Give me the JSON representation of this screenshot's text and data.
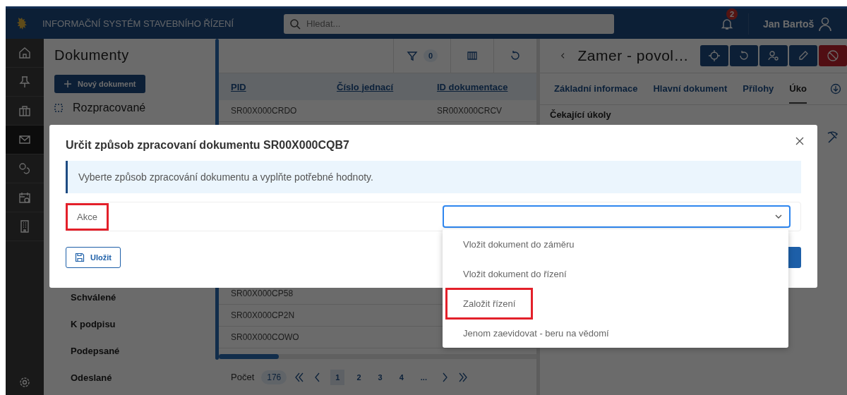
{
  "header": {
    "title": "INFORMAČNÍ SYSTÉM STAVEBNÍHO ŘÍZENÍ",
    "search": {
      "placeholder": "Hledat..."
    },
    "notifications": "2",
    "user": "Jan Bartoš"
  },
  "nav_rail": [
    {
      "kind": "home",
      "selected": false
    },
    {
      "kind": "pin",
      "selected": false
    },
    {
      "kind": "briefcase",
      "selected": false
    },
    {
      "kind": "mail",
      "selected": true
    },
    {
      "kind": "coins",
      "selected": false
    },
    {
      "kind": "calendar",
      "selected": false
    },
    {
      "kind": "building",
      "selected": false
    }
  ],
  "documents": {
    "title": "Dokumenty",
    "new_button": "Nový dokument",
    "folders": [
      {
        "kind": "group",
        "label": "Rozpracované"
      },
      {
        "kind": "item",
        "label": "Schválené"
      },
      {
        "kind": "item",
        "label": "K podpisu"
      },
      {
        "kind": "item",
        "label": "Podepsané"
      },
      {
        "kind": "item",
        "label": "Odeslané"
      }
    ]
  },
  "table": {
    "filter_count": "0",
    "columns": [
      "PID",
      "Číslo jednací",
      "ID dokumentace"
    ],
    "rows": [
      {
        "pid": "SR00X000CRDO",
        "id_dokumentace": "SR00X000CRCV"
      },
      {
        "pid": "SR00X000CP58"
      },
      {
        "pid": "SR00X000CP2N"
      },
      {
        "pid": "SR00X000COWO"
      }
    ],
    "pagination": {
      "label": "Počet",
      "total": "176",
      "pages": [
        {
          "label": "1",
          "selected": true
        },
        {
          "label": "2",
          "selected": false
        },
        {
          "label": "3",
          "selected": false
        },
        {
          "label": "4",
          "selected": false
        },
        {
          "label": "...",
          "selected": false
        }
      ]
    }
  },
  "detail": {
    "title": "Zamer - povol…",
    "actions": [
      {
        "kind": "locate"
      },
      {
        "kind": "refresh"
      },
      {
        "kind": "assign"
      },
      {
        "kind": "edit"
      },
      {
        "kind": "cancel"
      }
    ],
    "tabs": [
      {
        "label": "Základní informace",
        "selected": false
      },
      {
        "label": "Hlavní dokument",
        "selected": false
      },
      {
        "label": "Přílohy",
        "selected": false
      },
      {
        "label": "Úko",
        "selected": true
      }
    ],
    "section": "Čekající úkoly"
  },
  "dialog": {
    "title": "Určit způsob zpracovaní dokumentu SR00X000CQB7",
    "info": "Vyberte způsob zpracování dokumentu a vyplňte potřebné hodnoty.",
    "field": {
      "label": "Akce",
      "highlighted": true
    },
    "options": [
      {
        "label": "Vložit dokument do záměru",
        "highlighted": false
      },
      {
        "label": "Vložit dokument do řízení",
        "highlighted": false
      },
      {
        "label": "Založit řízení",
        "highlighted": true
      },
      {
        "label": "Jenom zaevidovat - beru na vědomí",
        "highlighted": false
      }
    ],
    "save": "Uložit"
  }
}
